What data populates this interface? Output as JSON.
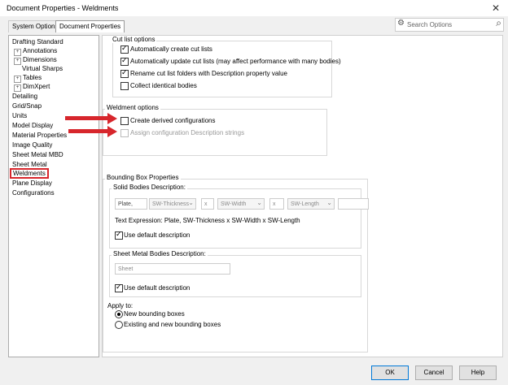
{
  "window": {
    "title": "Document Properties - Weldments",
    "close_label": "✕"
  },
  "tabs": [
    "System Options",
    "Document Properties"
  ],
  "search": {
    "placeholder": "Search Options"
  },
  "tree": [
    "Drafting Standard",
    "Annotations",
    "Dimensions",
    "Virtual Sharps",
    "Tables",
    "DimXpert",
    "Detailing",
    "Grid/Snap",
    "Units",
    "Model Display",
    "Material Properties",
    "Image Quality",
    "Sheet Metal MBD",
    "Sheet Metal",
    "Weldments",
    "Plane Display",
    "Configurations"
  ],
  "cut_list": {
    "title": "Cut list options",
    "options": [
      "Automatically create cut lists",
      "Automatically update cut lists (may affect performance with many bodies)",
      "Rename cut list folders with Description property value",
      "Collect identical bodies"
    ]
  },
  "weldment_options": {
    "title": "Weldment options",
    "create_derived": "Create derived configurations",
    "assign_desc": "Assign configuration Description strings"
  },
  "bounding": {
    "title": "Bounding Box Properties",
    "solid_title": "Solid Bodies Description:",
    "fields": [
      "Plate,",
      "SW-Thickness",
      "x",
      "SW-Width",
      "x",
      "SW-Length"
    ],
    "text_expression": "Text Expression: Plate, SW-Thickness x SW-Width x SW-Length",
    "use_default": "Use default description",
    "sheet_title": "Sheet Metal Bodies Description:",
    "sheet_value": "Sheet",
    "apply_to": "Apply to:",
    "radio_new": "New bounding boxes",
    "radio_existing": "Existing and new bounding boxes"
  },
  "buttons": {
    "ok": "OK",
    "cancel": "Cancel",
    "help": "Help"
  }
}
